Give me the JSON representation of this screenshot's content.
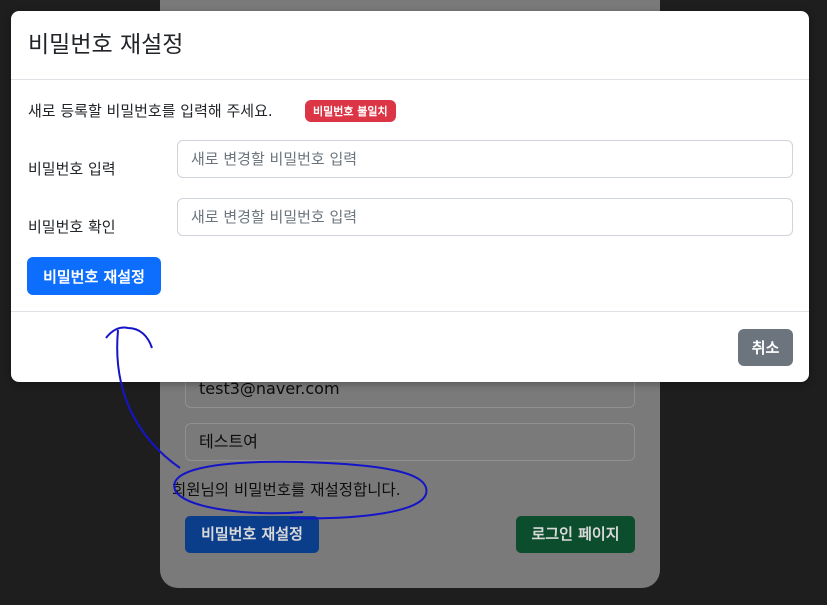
{
  "background": {
    "email_value": "test3@naver.com",
    "name_value": "테스트여",
    "message": "회원님의 비밀번호를 재설정합니다.",
    "reset_button": "비밀번호 재설정",
    "login_button": "로그인 페이지"
  },
  "modal": {
    "title": "비밀번호 재설정",
    "description": "새로 등록할 비밀번호를 입력해 주세요.",
    "badge": "비밀번호 불일치",
    "password_label": "비밀번호 입력",
    "password_placeholder": "새로 변경할 비밀번호 입력",
    "confirm_label": "비밀번호 확인",
    "confirm_placeholder": "새로 변경할 비밀번호 입력",
    "submit_label": "비밀번호 재설정",
    "cancel_label": "취소"
  },
  "colors": {
    "primary": "#0d6efd",
    "danger": "#dc3545",
    "secondary": "#6c757d",
    "success": "#198754",
    "annotation": "#1515c8"
  }
}
